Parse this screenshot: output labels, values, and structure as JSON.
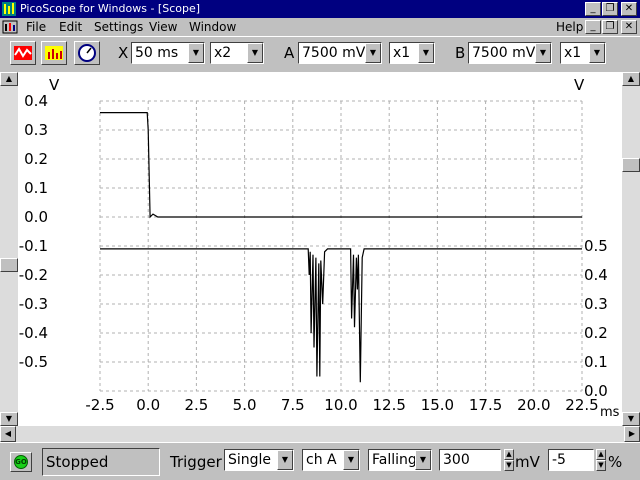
{
  "window": {
    "title": "PicoScope for Windows - [Scope]",
    "minimize_glyph": "_",
    "restore_glyph": "❐",
    "close_glyph": "✕"
  },
  "menu": {
    "items": [
      "File",
      "Edit",
      "Settings",
      "View",
      "Window"
    ],
    "help": "Help"
  },
  "toolbar": {
    "x_label": "X",
    "timebase": "50 ms",
    "x_multiplier": "x2",
    "a_label": "A",
    "a_range": "7500 mV",
    "a_multiplier": "x1",
    "b_label": "B",
    "b_range": "7500 mV",
    "b_multiplier": "x1"
  },
  "chart_data": {
    "type": "line",
    "left_unit": "V",
    "right_unit": "V",
    "x_unit": "ms",
    "x_ticks": [
      "-2.5",
      "0.0",
      "2.5",
      "5.0",
      "7.5",
      "10.0",
      "12.5",
      "15.0",
      "17.5",
      "20.0",
      "22.5"
    ],
    "x_range": [
      -2.5,
      22.5
    ],
    "y_left_ticks": [
      "0.4",
      "0.3",
      "0.2",
      "0.1",
      "0.0",
      "-0.1",
      "-0.2",
      "-0.3",
      "-0.4",
      "-0.5"
    ],
    "y_left_range": [
      -0.6,
      0.4
    ],
    "y_right_ticks": [
      "0.5",
      "0.4",
      "0.3",
      "0.2",
      "0.1",
      "0.0"
    ],
    "y_right_range": [
      0.0,
      0.5
    ],
    "grid": true,
    "series": [
      {
        "axis": "left",
        "color": "#000000",
        "points": [
          [
            -2.5,
            0.36
          ],
          [
            -0.05,
            0.36
          ],
          [
            0.0,
            0.3
          ],
          [
            0.1,
            0.0
          ],
          [
            0.25,
            0.01
          ],
          [
            0.5,
            0.0
          ],
          [
            22.5,
            0.0
          ]
        ]
      },
      {
        "axis": "right",
        "color": "#000000",
        "points": [
          [
            -2.5,
            0.49
          ],
          [
            8.3,
            0.49
          ],
          [
            8.35,
            0.4
          ],
          [
            8.4,
            0.48
          ],
          [
            8.45,
            0.2
          ],
          [
            8.55,
            0.47
          ],
          [
            8.6,
            0.15
          ],
          [
            8.7,
            0.46
          ],
          [
            8.75,
            0.05
          ],
          [
            8.85,
            0.44
          ],
          [
            8.9,
            0.05
          ],
          [
            8.95,
            0.45
          ],
          [
            9.05,
            0.3
          ],
          [
            9.15,
            0.48
          ],
          [
            9.3,
            0.49
          ],
          [
            10.5,
            0.49
          ],
          [
            10.55,
            0.25
          ],
          [
            10.65,
            0.47
          ],
          [
            10.7,
            0.22
          ],
          [
            10.8,
            0.46
          ],
          [
            10.85,
            0.35
          ],
          [
            10.9,
            0.47
          ],
          [
            11.0,
            0.03
          ],
          [
            11.1,
            0.46
          ],
          [
            11.2,
            0.49
          ],
          [
            22.5,
            0.49
          ]
        ]
      }
    ]
  },
  "statusbar": {
    "go_label": "GO",
    "status": "Stopped",
    "trigger_label": "Trigger",
    "trigger_mode": "Single",
    "trigger_channel": "ch A",
    "trigger_edge": "Falling",
    "trigger_level": "300",
    "level_unit": "mV",
    "pretrigger": "-5",
    "pretrigger_unit": "%"
  }
}
